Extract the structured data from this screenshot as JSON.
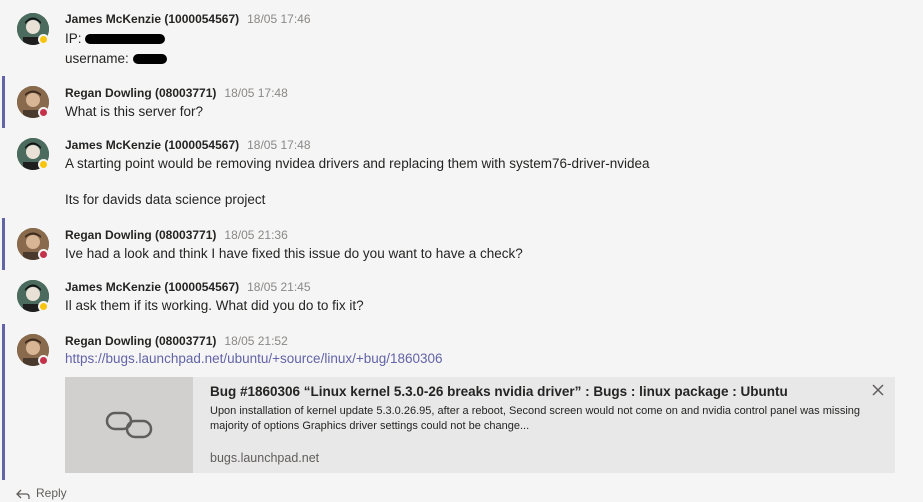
{
  "messages": [
    {
      "author": "James McKenzie (1000054567)",
      "time": "18/05 17:46",
      "lines": [
        "IP:",
        "username:"
      ]
    },
    {
      "author": "Regan Dowling (08003771)",
      "time": "18/05 17:48",
      "lines": [
        "What is this server for?"
      ]
    },
    {
      "author": "James McKenzie (1000054567)",
      "time": "18/05 17:48",
      "lines": [
        "A starting point would be removing nvidea drivers and replacing them with system76-driver-nvidea",
        "Its for davids data science project"
      ]
    },
    {
      "author": "Regan Dowling (08003771)",
      "time": "18/05 21:36",
      "lines": [
        "Ive had a look and think I have fixed this issue do you want to have a check?"
      ]
    },
    {
      "author": "James McKenzie (1000054567)",
      "time": "18/05 21:45",
      "lines": [
        "Il ask them if its working. What did you do to fix it?"
      ]
    },
    {
      "author": "Regan Dowling (08003771)",
      "time": "18/05 21:52",
      "lines": [
        "https://bugs.launchpad.net/ubuntu/+source/linux/+bug/1860306"
      ]
    }
  ],
  "link_card": {
    "title": "Bug #1860306 “Linux kernel 5.3.0-26 breaks nvidia driver” : Bugs : linux package : Ubuntu",
    "description": "Upon installation of kernel update 5.3.0.26.95, after a reboot, Second screen would not come on and nvidia control panel was missing majority of options Graphics driver settings could not be change...",
    "domain": "bugs.launchpad.net",
    "icon": "link-icon"
  },
  "reply_label": "Reply",
  "status": {
    "james": "away",
    "regan": "busy"
  },
  "colors": {
    "accent": "#6264a7",
    "away": "#f8c50c",
    "busy": "#c4314b"
  }
}
